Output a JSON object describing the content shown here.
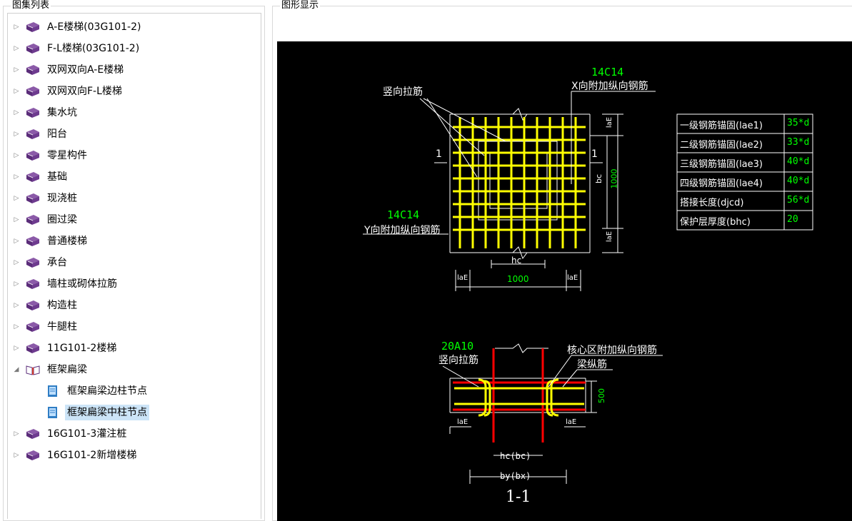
{
  "left_panel": {
    "title": "图集列表"
  },
  "right_panel": {
    "title": "图形显示"
  },
  "tree": {
    "items": [
      {
        "label": "A-E楼梯(03G101-2)"
      },
      {
        "label": "F-L楼梯(03G101-2)"
      },
      {
        "label": "双网双向A-E楼梯"
      },
      {
        "label": "双网双向F-L楼梯"
      },
      {
        "label": "集水坑"
      },
      {
        "label": "阳台"
      },
      {
        "label": "零星构件"
      },
      {
        "label": "基础"
      },
      {
        "label": "现浇桩"
      },
      {
        "label": "圈过梁"
      },
      {
        "label": "普通楼梯"
      },
      {
        "label": "承台"
      },
      {
        "label": "墙柱或砌体拉筋"
      },
      {
        "label": "构造柱"
      },
      {
        "label": "牛腿柱"
      },
      {
        "label": "11G101-2楼梯"
      },
      {
        "label": "框架扁梁",
        "expanded": true
      },
      {
        "label": "框架扁梁边柱节点",
        "child": true
      },
      {
        "label": "框架扁梁中柱节点",
        "child": true,
        "selected": true
      },
      {
        "label": "16G101-3灌注桩"
      },
      {
        "label": "16G101-2新增楼梯"
      }
    ]
  },
  "drawing": {
    "top_label_vertical_tie": "竖向拉筋",
    "x_bar_count": "14C14",
    "x_bar_desc": "X向附加纵向钢筋",
    "y_bar_count": "14C14",
    "y_bar_desc": "Y向附加纵向钢筋",
    "section_mark": "1",
    "dim_lae": "laE",
    "dim_bc": "bc",
    "dim_1000": "1000",
    "dim_hc": "hc",
    "bottom_tie_count": "20A10",
    "bottom_tie_label": "竖向拉筋",
    "core_bar_label": "核心区附加纵向钢筋",
    "beam_bar_label": "梁纵筋",
    "dim_500": "500",
    "dim_hcbc": "hc(bc)",
    "dim_bybx": "by(bx)",
    "section_title": "1-1"
  },
  "param_table": {
    "rows": [
      {
        "name": "一级钢筋锚固(lae1)",
        "value": "35*d"
      },
      {
        "name": "二级钢筋锚固(lae2)",
        "value": "33*d"
      },
      {
        "name": "三级钢筋锚固(lae3)",
        "value": "40*d"
      },
      {
        "name": "四级钢筋锚固(lae4)",
        "value": "40*d"
      },
      {
        "name": "搭接长度(djcd)",
        "value": "56*d"
      },
      {
        "name": "保护层厚度(bhc)",
        "value": "20"
      }
    ]
  },
  "colors": {
    "cad_bg": "#000000",
    "rebar": "#ffff00",
    "text_green": "#00ff00",
    "beam_red": "#ff0000",
    "select": "#cce4f7"
  }
}
